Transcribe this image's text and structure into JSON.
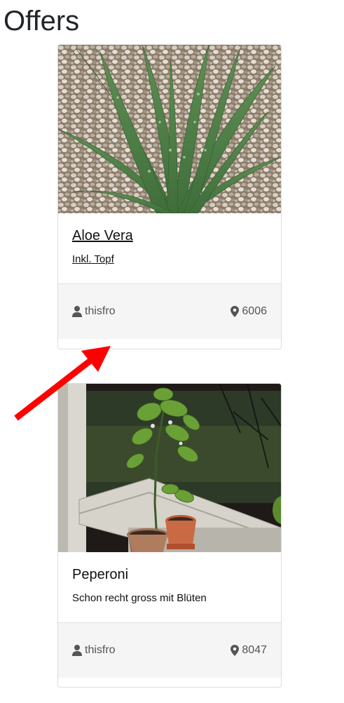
{
  "page": {
    "title": "Offers"
  },
  "offers": [
    {
      "title": "Aloe Vera",
      "description": "Inkl. Topf",
      "user": "thisfro",
      "location": "6006",
      "user_icon": "user-icon",
      "location_icon": "map-marker-icon"
    },
    {
      "title": "Peperoni",
      "description": "Schon recht gross mit Blüten",
      "user": "thisfro",
      "location": "8047",
      "user_icon": "user-icon",
      "location_icon": "map-marker-icon"
    }
  ],
  "colors": {
    "annotation_arrow": "#ff0000",
    "footer_bg": "#f5f5f5",
    "text": "#212529"
  }
}
